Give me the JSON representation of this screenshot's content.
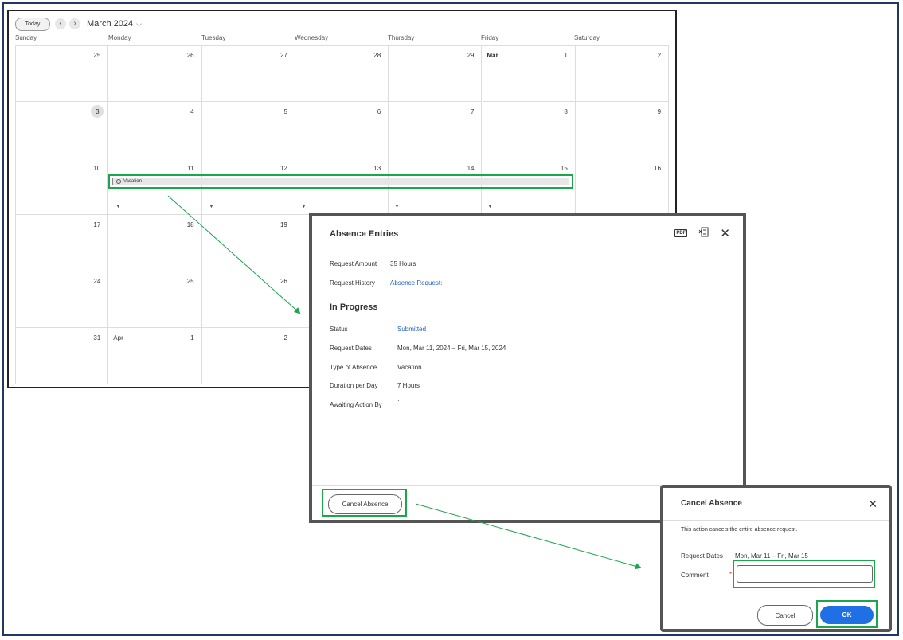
{
  "calendar": {
    "today_label": "Today",
    "prev_icon": "‹",
    "next_icon": "›",
    "month_title": "March 2024",
    "weekdays": [
      "Sunday",
      "Monday",
      "Tuesday",
      "Wednesday",
      "Thursday",
      "Friday",
      "Saturday"
    ],
    "days": [
      "25",
      "26",
      "27",
      "28",
      "29",
      "1",
      "2",
      "3",
      "4",
      "5",
      "6",
      "7",
      "8",
      "9",
      "10",
      "11",
      "12",
      "13",
      "14",
      "15",
      "16",
      "17",
      "18",
      "19",
      "",
      "",
      "",
      "",
      "24",
      "25",
      "26",
      "",
      "",
      "",
      "",
      "31",
      "1",
      "2",
      "",
      "",
      "",
      ""
    ],
    "mar_label": "Mar",
    "apr_label": "Apr",
    "event_label": "Vacation"
  },
  "absence_entries": {
    "title": "Absence Entries",
    "request_amount_label": "Request Amount",
    "request_amount_value": "35 Hours",
    "request_history_label": "Request History",
    "request_history_value": "Absence Request:",
    "section_title": "In Progress",
    "status_label": "Status",
    "status_value": "Submitted",
    "request_dates_label": "Request Dates",
    "request_dates_value": "Mon, Mar 11, 2024 – Fri, Mar 15, 2024",
    "type_label": "Type of Absence",
    "type_value": "Vacation",
    "duration_label": "Duration per Day",
    "duration_value": "7 Hours",
    "awaiting_label": "Awaiting Action By",
    "awaiting_value": "·",
    "cancel_absence_label": "Cancel Absence",
    "pdf_icon_text": "PDF"
  },
  "cancel_dialog": {
    "title": "Cancel Absence",
    "message": "This action cancels the entire absence request.",
    "request_dates_label": "Request Dates",
    "request_dates_value": "Mon, Mar 11 – Fri, Mar 15",
    "comment_label": "Comment",
    "comment_value": "",
    "required_mark": "*",
    "cancel_label": "Cancel",
    "ok_label": "OK"
  },
  "colors": {
    "highlight": "#1aa64b",
    "primary": "#1f6fe5",
    "link": "#1f5fbd"
  }
}
